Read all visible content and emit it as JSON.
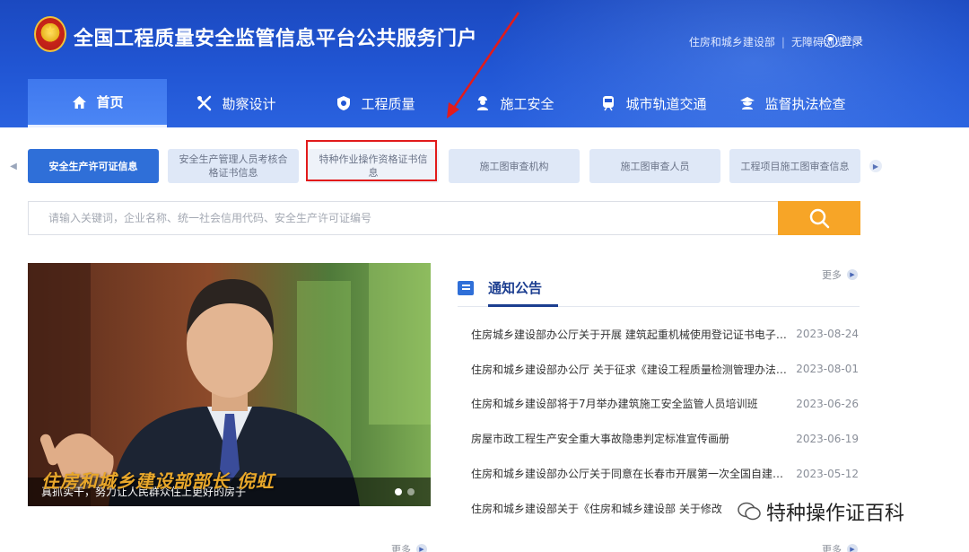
{
  "header": {
    "site_title": "全国工程质量安全监管信息平台公共服务门户",
    "links": [
      "住房和城乡建设部",
      "无障碍浏览"
    ],
    "login_label": "登录"
  },
  "nav": [
    {
      "label": "首页",
      "icon": "home-icon",
      "active": true
    },
    {
      "label": "勘察设计",
      "icon": "tools-icon"
    },
    {
      "label": "工程质量",
      "icon": "shield-icon"
    },
    {
      "label": "施工安全",
      "icon": "worker-icon"
    },
    {
      "label": "城市轨道交通",
      "icon": "train-icon"
    },
    {
      "label": "监督执法检查",
      "icon": "inspector-icon"
    }
  ],
  "categories": [
    {
      "label": "安全生产许可证信息",
      "active": true
    },
    {
      "label": "安全生产管理人员考核合格证书信息"
    },
    {
      "label": "特种作业操作资格证书信息",
      "highlighted": true
    },
    {
      "label": "施工图审查机构"
    },
    {
      "label": "施工图审查人员"
    },
    {
      "label": "工程项目施工图审查信息"
    }
  ],
  "search": {
    "placeholder": "请输入关键词，企业名称、统一社会信用代码、安全生产许可证编号"
  },
  "banner": {
    "overlay_text": "住房和城乡建设部部长 倪虹",
    "caption": "真抓实干，努力让人民群众住上更好的房子"
  },
  "more_label": "更多",
  "notices": {
    "title": "通知公告",
    "items": [
      {
        "title": "住房城乡建设部办公厅关于开展 建筑起重机械使用登记证书电子证照试运行工作的通知",
        "date": "2023-08-24"
      },
      {
        "title": "住房和城乡建设部办公厅 关于征求《建设工程质量检测管理办法》实施意见的函",
        "date": "2023-08-01"
      },
      {
        "title": "住房和城乡建设部将于7月举办建筑施工安全监管人员培训班",
        "date": "2023-06-26"
      },
      {
        "title": "房屋市政工程生产安全重大事故隐患判定标准宣传画册",
        "date": "2023-06-19"
      },
      {
        "title": "住房和城乡建设部办公厅关于同意在长春市开展第一次全国自建房安全专项整治工作的函",
        "date": "2023-05-12"
      },
      {
        "title": "住房和城乡建设部关于《住房和城乡建设部 关于修改",
        "date": ""
      }
    ]
  },
  "watermark": "特种操作证百科",
  "colors": {
    "header_blue": "#1b49c0",
    "active_tab": "#2f6fd8",
    "search_button": "#f7a527",
    "highlight_red": "#e21b1b"
  }
}
